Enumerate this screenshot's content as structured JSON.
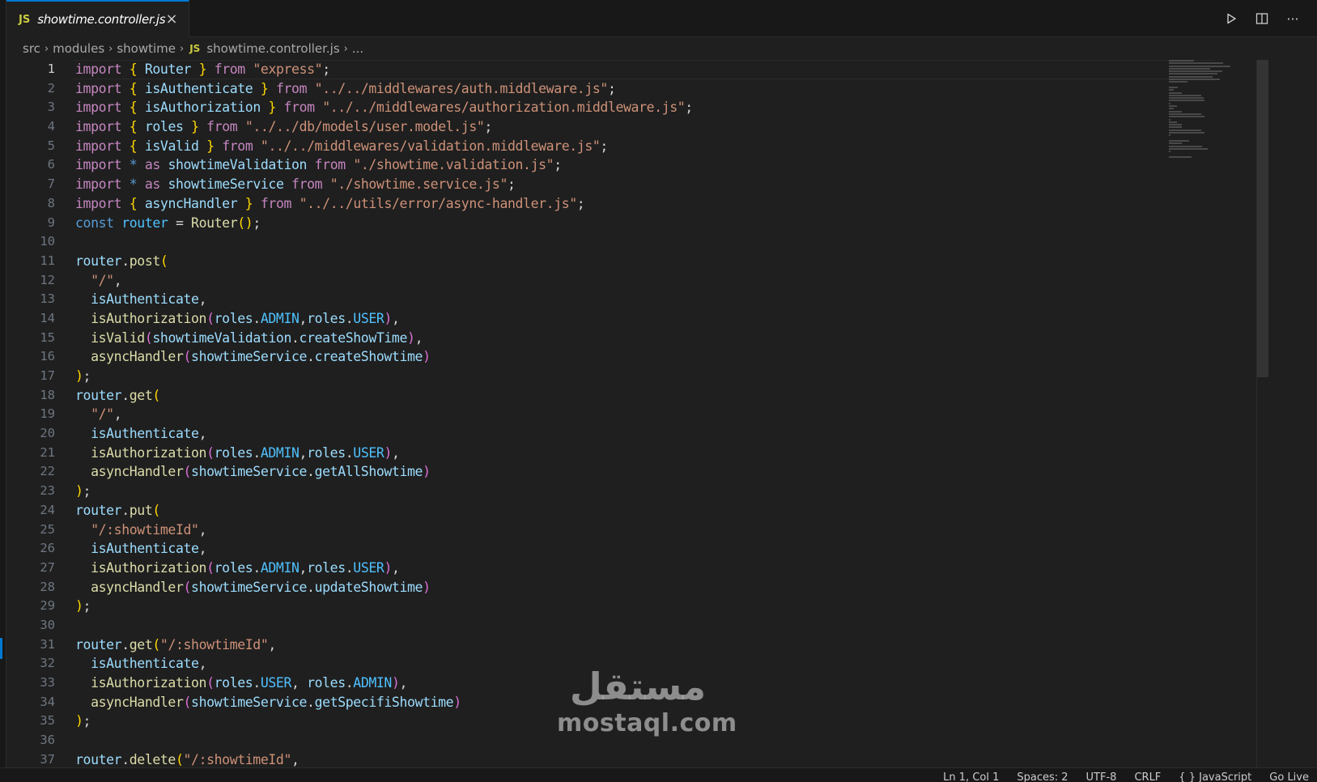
{
  "tab": {
    "badge": "JS",
    "title": "showtime.controller.js",
    "close": "×"
  },
  "actions": {
    "run": "run-icon",
    "split": "split-editor-icon",
    "more": "···"
  },
  "breadcrumb": {
    "parts": [
      "src",
      "modules",
      "showtime"
    ],
    "badge": "JS",
    "file": "showtime.controller.js",
    "tail": "...",
    "sep": "›"
  },
  "editor": {
    "active_line": 1,
    "lines": [
      [
        [
          "kw",
          "import"
        ],
        [
          "op",
          " "
        ],
        [
          "br",
          "{"
        ],
        [
          "op",
          " "
        ],
        [
          "var",
          "Router"
        ],
        [
          "op",
          " "
        ],
        [
          "br",
          "}"
        ],
        [
          "op",
          " "
        ],
        [
          "kw",
          "from"
        ],
        [
          "op",
          " "
        ],
        [
          "str",
          "\"express\""
        ],
        [
          "op",
          ";"
        ]
      ],
      [
        [
          "kw",
          "import"
        ],
        [
          "op",
          " "
        ],
        [
          "br",
          "{"
        ],
        [
          "op",
          " "
        ],
        [
          "var",
          "isAuthenticate"
        ],
        [
          "op",
          " "
        ],
        [
          "br",
          "}"
        ],
        [
          "op",
          " "
        ],
        [
          "kw",
          "from"
        ],
        [
          "op",
          " "
        ],
        [
          "str",
          "\"../../middlewares/auth.middleware.js\""
        ],
        [
          "op",
          ";"
        ]
      ],
      [
        [
          "kw",
          "import"
        ],
        [
          "op",
          " "
        ],
        [
          "br",
          "{"
        ],
        [
          "op",
          " "
        ],
        [
          "var",
          "isAuthorization"
        ],
        [
          "op",
          " "
        ],
        [
          "br",
          "}"
        ],
        [
          "op",
          " "
        ],
        [
          "kw",
          "from"
        ],
        [
          "op",
          " "
        ],
        [
          "str",
          "\"../../middlewares/authorization.middleware.js\""
        ],
        [
          "op",
          ";"
        ]
      ],
      [
        [
          "kw",
          "import"
        ],
        [
          "op",
          " "
        ],
        [
          "br",
          "{"
        ],
        [
          "op",
          " "
        ],
        [
          "var",
          "roles"
        ],
        [
          "op",
          " "
        ],
        [
          "br",
          "}"
        ],
        [
          "op",
          " "
        ],
        [
          "kw",
          "from"
        ],
        [
          "op",
          " "
        ],
        [
          "str",
          "\"../../db/models/user.model.js\""
        ],
        [
          "op",
          ";"
        ]
      ],
      [
        [
          "kw",
          "import"
        ],
        [
          "op",
          " "
        ],
        [
          "br",
          "{"
        ],
        [
          "op",
          " "
        ],
        [
          "var",
          "isValid"
        ],
        [
          "op",
          " "
        ],
        [
          "br",
          "}"
        ],
        [
          "op",
          " "
        ],
        [
          "kw",
          "from"
        ],
        [
          "op",
          " "
        ],
        [
          "str",
          "\"../../middlewares/validation.middleware.js\""
        ],
        [
          "op",
          ";"
        ]
      ],
      [
        [
          "kw",
          "import"
        ],
        [
          "op",
          " "
        ],
        [
          "decl",
          "*"
        ],
        [
          "op",
          " "
        ],
        [
          "kw",
          "as"
        ],
        [
          "op",
          " "
        ],
        [
          "var",
          "showtimeValidation"
        ],
        [
          "op",
          " "
        ],
        [
          "kw",
          "from"
        ],
        [
          "op",
          " "
        ],
        [
          "str",
          "\"./showtime.validation.js\""
        ],
        [
          "op",
          ";"
        ]
      ],
      [
        [
          "kw",
          "import"
        ],
        [
          "op",
          " "
        ],
        [
          "decl",
          "*"
        ],
        [
          "op",
          " "
        ],
        [
          "kw",
          "as"
        ],
        [
          "op",
          " "
        ],
        [
          "var",
          "showtimeService"
        ],
        [
          "op",
          " "
        ],
        [
          "kw",
          "from"
        ],
        [
          "op",
          " "
        ],
        [
          "str",
          "\"./showtime.service.js\""
        ],
        [
          "op",
          ";"
        ]
      ],
      [
        [
          "kw",
          "import"
        ],
        [
          "op",
          " "
        ],
        [
          "br",
          "{"
        ],
        [
          "op",
          " "
        ],
        [
          "var",
          "asyncHandler"
        ],
        [
          "op",
          " "
        ],
        [
          "br",
          "}"
        ],
        [
          "op",
          " "
        ],
        [
          "kw",
          "from"
        ],
        [
          "op",
          " "
        ],
        [
          "str",
          "\"../../utils/error/async-handler.js\""
        ],
        [
          "op",
          ";"
        ]
      ],
      [
        [
          "decl",
          "const"
        ],
        [
          "op",
          " "
        ],
        [
          "con",
          "router"
        ],
        [
          "op",
          " = "
        ],
        [
          "fn",
          "Router"
        ],
        [
          "br",
          "()"
        ],
        [
          "op",
          ";"
        ]
      ],
      [],
      [
        [
          "var",
          "router"
        ],
        [
          "op",
          "."
        ],
        [
          "fn",
          "post"
        ],
        [
          "br",
          "("
        ]
      ],
      [
        [
          "op",
          "  "
        ],
        [
          "str",
          "\"/\""
        ],
        [
          "op",
          ","
        ]
      ],
      [
        [
          "op",
          "  "
        ],
        [
          "var",
          "isAuthenticate"
        ],
        [
          "op",
          ","
        ]
      ],
      [
        [
          "op",
          "  "
        ],
        [
          "fn",
          "isAuthorization"
        ],
        [
          "br2",
          "("
        ],
        [
          "var",
          "roles"
        ],
        [
          "op",
          "."
        ],
        [
          "con",
          "ADMIN"
        ],
        [
          "op",
          ","
        ],
        [
          "var",
          "roles"
        ],
        [
          "op",
          "."
        ],
        [
          "con",
          "USER"
        ],
        [
          "br2",
          ")"
        ],
        [
          "op",
          ","
        ]
      ],
      [
        [
          "op",
          "  "
        ],
        [
          "fn",
          "isValid"
        ],
        [
          "br2",
          "("
        ],
        [
          "var",
          "showtimeValidation"
        ],
        [
          "op",
          "."
        ],
        [
          "var",
          "createShowTime"
        ],
        [
          "br2",
          ")"
        ],
        [
          "op",
          ","
        ]
      ],
      [
        [
          "op",
          "  "
        ],
        [
          "fn",
          "asyncHandler"
        ],
        [
          "br2",
          "("
        ],
        [
          "var",
          "showtimeService"
        ],
        [
          "op",
          "."
        ],
        [
          "var",
          "createShowtime"
        ],
        [
          "br2",
          ")"
        ]
      ],
      [
        [
          "br",
          ")"
        ],
        [
          "op",
          ";"
        ]
      ],
      [
        [
          "var",
          "router"
        ],
        [
          "op",
          "."
        ],
        [
          "fn",
          "get"
        ],
        [
          "br",
          "("
        ]
      ],
      [
        [
          "op",
          "  "
        ],
        [
          "str",
          "\"/\""
        ],
        [
          "op",
          ","
        ]
      ],
      [
        [
          "op",
          "  "
        ],
        [
          "var",
          "isAuthenticate"
        ],
        [
          "op",
          ","
        ]
      ],
      [
        [
          "op",
          "  "
        ],
        [
          "fn",
          "isAuthorization"
        ],
        [
          "br2",
          "("
        ],
        [
          "var",
          "roles"
        ],
        [
          "op",
          "."
        ],
        [
          "con",
          "ADMIN"
        ],
        [
          "op",
          ","
        ],
        [
          "var",
          "roles"
        ],
        [
          "op",
          "."
        ],
        [
          "con",
          "USER"
        ],
        [
          "br2",
          ")"
        ],
        [
          "op",
          ","
        ]
      ],
      [
        [
          "op",
          "  "
        ],
        [
          "fn",
          "asyncHandler"
        ],
        [
          "br2",
          "("
        ],
        [
          "var",
          "showtimeService"
        ],
        [
          "op",
          "."
        ],
        [
          "var",
          "getAllShowtime"
        ],
        [
          "br2",
          ")"
        ]
      ],
      [
        [
          "br",
          ")"
        ],
        [
          "op",
          ";"
        ]
      ],
      [
        [
          "var",
          "router"
        ],
        [
          "op",
          "."
        ],
        [
          "fn",
          "put"
        ],
        [
          "br",
          "("
        ]
      ],
      [
        [
          "op",
          "  "
        ],
        [
          "str",
          "\"/:showtimeId\""
        ],
        [
          "op",
          ","
        ]
      ],
      [
        [
          "op",
          "  "
        ],
        [
          "var",
          "isAuthenticate"
        ],
        [
          "op",
          ","
        ]
      ],
      [
        [
          "op",
          "  "
        ],
        [
          "fn",
          "isAuthorization"
        ],
        [
          "br2",
          "("
        ],
        [
          "var",
          "roles"
        ],
        [
          "op",
          "."
        ],
        [
          "con",
          "ADMIN"
        ],
        [
          "op",
          ","
        ],
        [
          "var",
          "roles"
        ],
        [
          "op",
          "."
        ],
        [
          "con",
          "USER"
        ],
        [
          "br2",
          ")"
        ],
        [
          "op",
          ","
        ]
      ],
      [
        [
          "op",
          "  "
        ],
        [
          "fn",
          "asyncHandler"
        ],
        [
          "br2",
          "("
        ],
        [
          "var",
          "showtimeService"
        ],
        [
          "op",
          "."
        ],
        [
          "var",
          "updateShowtime"
        ],
        [
          "br2",
          ")"
        ]
      ],
      [
        [
          "br",
          ")"
        ],
        [
          "op",
          ";"
        ]
      ],
      [],
      [
        [
          "var",
          "router"
        ],
        [
          "op",
          "."
        ],
        [
          "fn",
          "get"
        ],
        [
          "br",
          "("
        ],
        [
          "str",
          "\"/:showtimeId\""
        ],
        [
          "op",
          ","
        ]
      ],
      [
        [
          "op",
          "  "
        ],
        [
          "var",
          "isAuthenticate"
        ],
        [
          "op",
          ","
        ]
      ],
      [
        [
          "op",
          "  "
        ],
        [
          "fn",
          "isAuthorization"
        ],
        [
          "br2",
          "("
        ],
        [
          "var",
          "roles"
        ],
        [
          "op",
          "."
        ],
        [
          "con",
          "USER"
        ],
        [
          "op",
          ", "
        ],
        [
          "var",
          "roles"
        ],
        [
          "op",
          "."
        ],
        [
          "con",
          "ADMIN"
        ],
        [
          "br2",
          ")"
        ],
        [
          "op",
          ","
        ]
      ],
      [
        [
          "op",
          "  "
        ],
        [
          "fn",
          "asyncHandler"
        ],
        [
          "br2",
          "("
        ],
        [
          "var",
          "showtimeService"
        ],
        [
          "op",
          "."
        ],
        [
          "var",
          "getSpecifiShowtime"
        ],
        [
          "br2",
          ")"
        ]
      ],
      [
        [
          "br",
          ")"
        ],
        [
          "op",
          ";"
        ]
      ],
      [],
      [
        [
          "var",
          "router"
        ],
        [
          "op",
          "."
        ],
        [
          "fn",
          "delete"
        ],
        [
          "br",
          "("
        ],
        [
          "str",
          "\"/:showtimeId\""
        ],
        [
          "op",
          ","
        ]
      ]
    ]
  },
  "watermark": {
    "arabic": "مستقل",
    "latin": "mostaql.com"
  },
  "status": {
    "position": "Ln 1, Col 1",
    "spaces": "Spaces: 2",
    "encoding": "UTF-8",
    "eol": "CRLF",
    "language": "{ } JavaScript",
    "golive": "Go Live"
  },
  "colors": {
    "accent": "#0078d4",
    "background": "#1f1f1f",
    "keyword": "#c586c0",
    "string": "#ce9178",
    "variable": "#9cdcfe",
    "function": "#dcdcaa",
    "bracket": "#ffd700"
  }
}
